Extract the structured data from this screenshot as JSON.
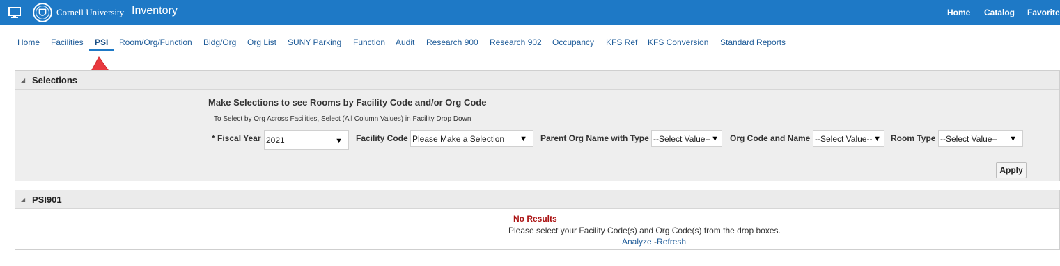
{
  "header": {
    "university": "Cornell University",
    "app_title": "Inventory",
    "links": [
      "Home",
      "Catalog",
      "Favorites"
    ],
    "icons": {
      "monitor": "monitor-icon",
      "seal": "cornell-seal-logo"
    },
    "bar_color": "#1e79c6"
  },
  "tabs": [
    "Home",
    "Facilities",
    "PSI",
    "Room/Org/Function",
    "Bldg/Org",
    "Org List",
    "SUNY Parking",
    "Function",
    "Audit",
    "Research 900",
    "Research 902",
    "Occupancy",
    "KFS Ref",
    "KFS Conversion",
    "Standard Reports"
  ],
  "active_tab": "PSI",
  "selections": {
    "title": "Selections",
    "heading": "Make Selections to see Rooms by Facility Code and/or Org Code",
    "subheading": "To Select by Org Across Facilities, Select (All Column Values) in Facility Drop Down",
    "fiscal_year_label": "* Fiscal Year",
    "fiscal_year_value": "2021",
    "facility_code_label": "Facility Code",
    "facility_code_value": "Please Make a Selection",
    "parent_org_label": "Parent Org Name with Type",
    "parent_org_value": "--Select Value--",
    "org_code_label": "Org Code and Name",
    "org_code_value": "--Select Value--",
    "room_type_label": "Room Type",
    "room_type_value": "--Select Value--",
    "apply_label": "Apply"
  },
  "results": {
    "title": "PSI901",
    "no_results": "No Results",
    "message": "Please select your Facility Code(s) and Org Code(s) from the drop boxes.",
    "analyze_label": "Analyze",
    "separator": "-",
    "refresh_label": "Refresh"
  },
  "annotation": {
    "arrow_color": "#e8393f"
  }
}
